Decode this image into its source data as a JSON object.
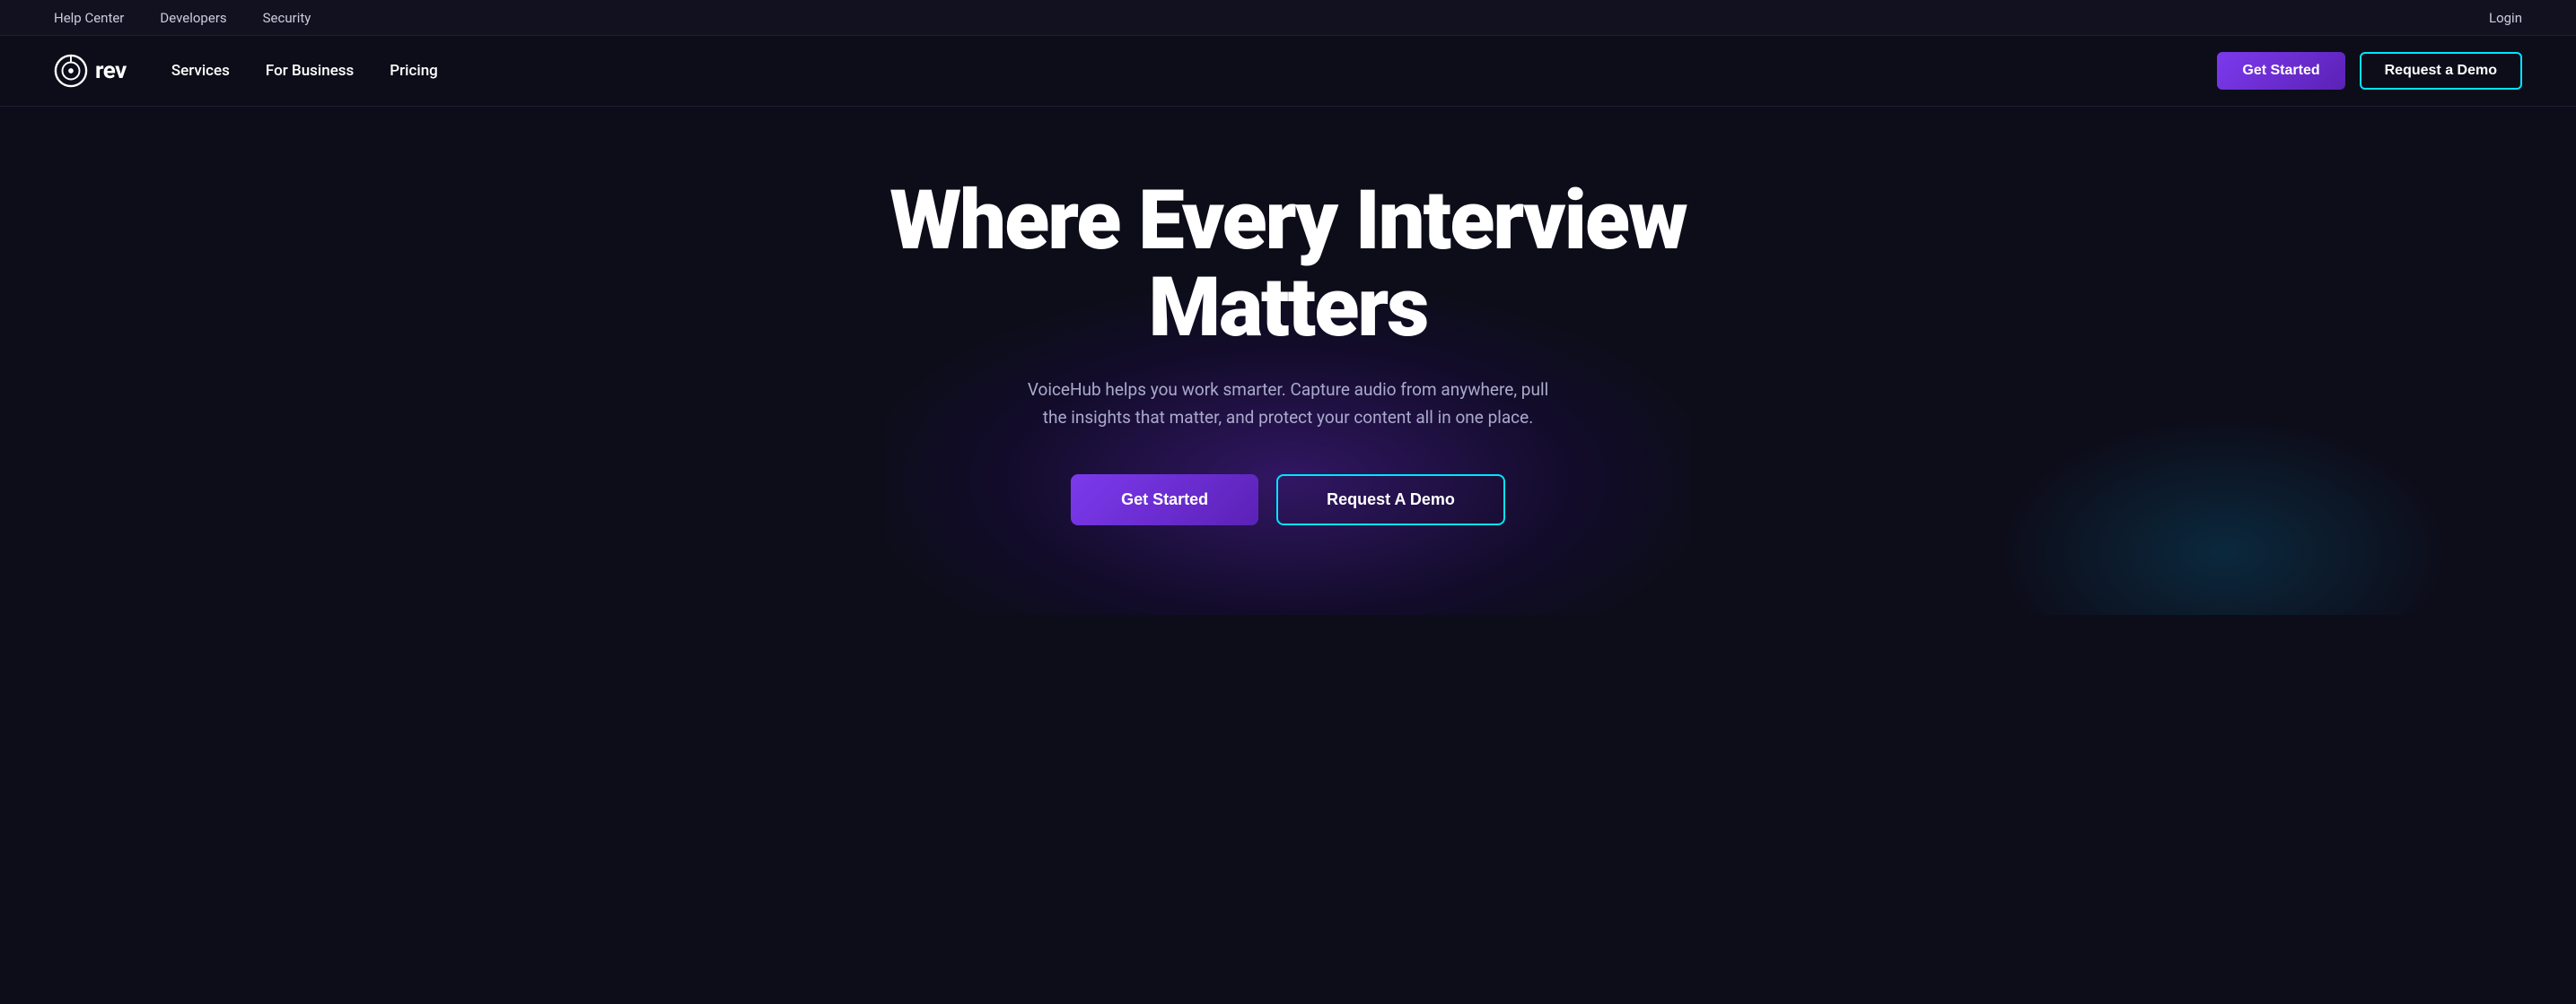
{
  "topBar": {
    "links": [
      {
        "label": "Help Center",
        "name": "help-center-link"
      },
      {
        "label": "Developers",
        "name": "developers-link"
      },
      {
        "label": "Security",
        "name": "security-link"
      }
    ],
    "loginLabel": "Login"
  },
  "mainNav": {
    "logoIconAlt": "rev-logo",
    "logoText": "rev",
    "navLinks": [
      {
        "label": "Services",
        "name": "services-nav-link"
      },
      {
        "label": "For Business",
        "name": "for-business-nav-link"
      },
      {
        "label": "Pricing",
        "name": "pricing-nav-link"
      }
    ],
    "getStartedLabel": "Get Started",
    "requestDemoLabel": "Request a Demo"
  },
  "hero": {
    "title": "Where Every Interview Matters",
    "subtitle": "VoiceHub helps you work smarter. Capture audio from anywhere, pull the insights that matter, and protect your content all in one place.",
    "getStartedLabel": "Get Started",
    "requestDemoLabel": "Request A Demo"
  },
  "colors": {
    "accent_purple": "#7c3aed",
    "accent_cyan": "#00e5ff",
    "bg_dark": "#0d0d1a"
  }
}
